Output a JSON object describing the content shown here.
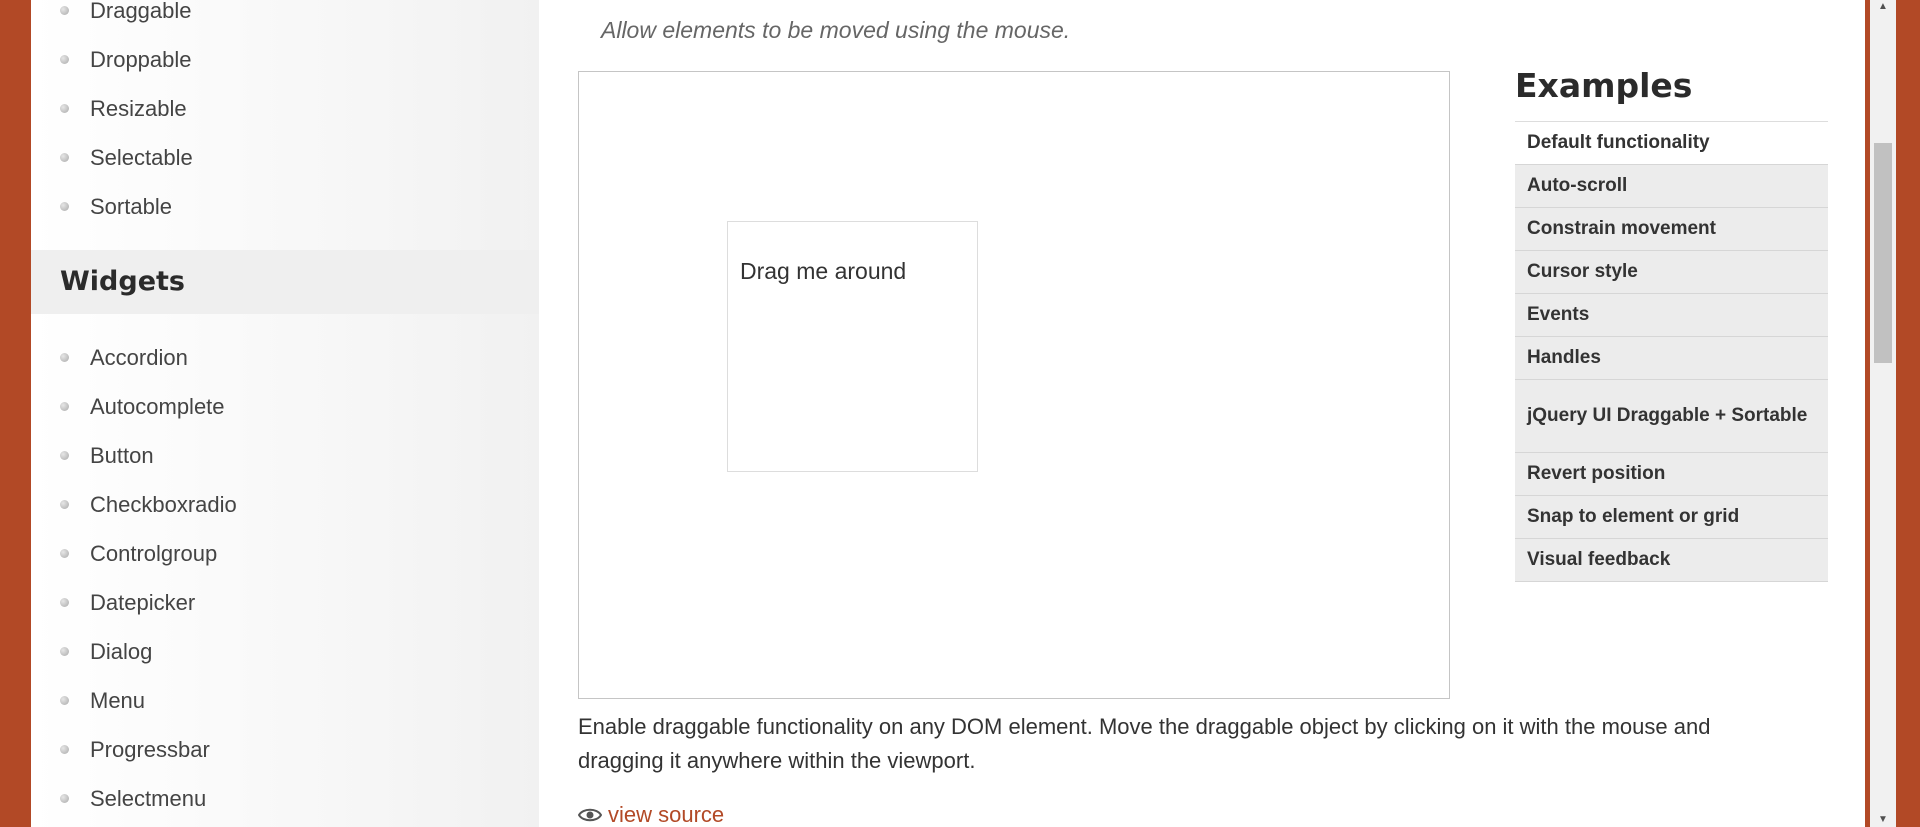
{
  "sidebar": {
    "interactions": [
      {
        "label": "Draggable"
      },
      {
        "label": "Droppable"
      },
      {
        "label": "Resizable"
      },
      {
        "label": "Selectable"
      },
      {
        "label": "Sortable"
      }
    ],
    "widgets_header": "Widgets",
    "widgets": [
      {
        "label": "Accordion"
      },
      {
        "label": "Autocomplete"
      },
      {
        "label": "Button"
      },
      {
        "label": "Checkboxradio"
      },
      {
        "label": "Controlgroup"
      },
      {
        "label": "Datepicker"
      },
      {
        "label": "Dialog"
      },
      {
        "label": "Menu"
      },
      {
        "label": "Progressbar"
      },
      {
        "label": "Selectmenu"
      }
    ]
  },
  "main": {
    "subtitle": "Allow elements to be moved using the mouse.",
    "draggable_text": "Drag me around",
    "description": "Enable draggable functionality on any DOM element. Move the draggable object by clicking on it with the mouse and dragging it anywhere within the viewport.",
    "view_source": "view source"
  },
  "examples": {
    "title": "Examples",
    "items": [
      {
        "label": "Default functionality"
      },
      {
        "label": "Auto-scroll"
      },
      {
        "label": "Constrain movement"
      },
      {
        "label": "Cursor style"
      },
      {
        "label": "Events"
      },
      {
        "label": "Handles"
      },
      {
        "label": "jQuery UI Draggable + Sortable"
      },
      {
        "label": "Revert position"
      },
      {
        "label": "Snap to element or grid"
      },
      {
        "label": "Visual feedback"
      }
    ]
  },
  "colors": {
    "brand": "#b24926",
    "link": "#b24926"
  },
  "icons": {
    "view_source": "eye-icon",
    "bullet": "bullet-icon",
    "scroll_up": "arrow-up-icon",
    "scroll_down": "arrow-down-icon"
  }
}
